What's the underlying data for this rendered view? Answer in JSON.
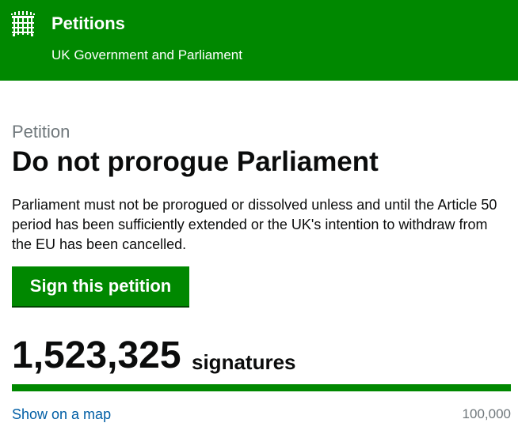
{
  "header": {
    "title": "Petitions",
    "subtitle": "UK Government and Parliament",
    "logo_icon": "portcullis-icon"
  },
  "petition": {
    "caption": "Petition",
    "title": "Do not prorogue Parliament",
    "description": "Parliament must not be prorogued or dissolved unless and until the Article 50 period has been sufficiently extended or the UK's intention to withdraw from the EU has been cancelled.",
    "sign_label": "Sign this petition"
  },
  "signatures": {
    "count": "1,523,325",
    "label": "signatures",
    "progress_fraction": 1.0,
    "target": "100,000",
    "map_link": "Show on a map"
  },
  "colors": {
    "brand_green": "#008800",
    "link_blue": "#005ea5",
    "secondary_text": "#6f777b"
  }
}
